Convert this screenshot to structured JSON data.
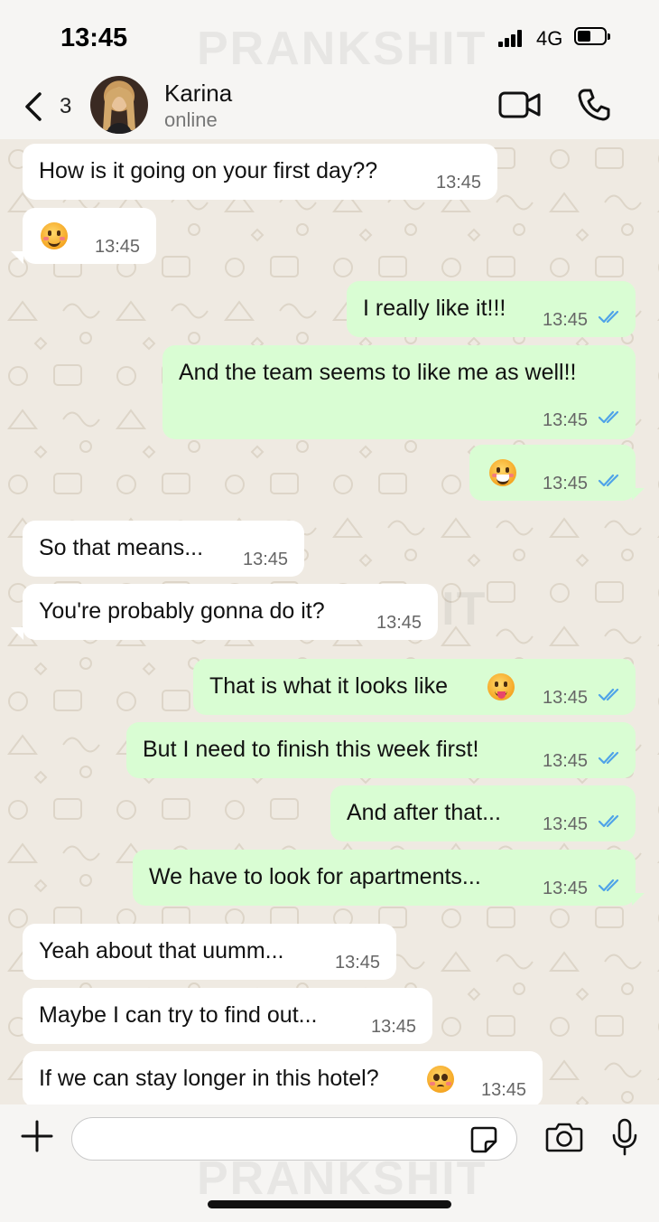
{
  "status_bar": {
    "time": "13:45",
    "network": "4G",
    "watermark": "PRANKSHIT"
  },
  "header": {
    "back_count": "3",
    "contact_name": "Karina",
    "contact_status": "online",
    "icons": [
      "chevron-left-icon",
      "video-camera-icon",
      "phone-icon"
    ]
  },
  "messages": [
    {
      "dir": "in",
      "text": "How is it going on your first day??",
      "time": "13:45"
    },
    {
      "dir": "in",
      "text": "",
      "emoji": "smiling-face-emoji",
      "time": "13:45"
    },
    {
      "dir": "out",
      "text": "I really like it!!!",
      "time": "13:45",
      "read": true
    },
    {
      "dir": "out",
      "text": "And the team seems to like me as well!!",
      "time": "13:45",
      "read": true
    },
    {
      "dir": "out",
      "text": "",
      "emoji": "grinning-face-emoji",
      "time": "13:45",
      "read": true
    },
    {
      "dir": "in",
      "text": "So that means...",
      "time": "13:45"
    },
    {
      "dir": "in",
      "text": "You're probably gonna do it?",
      "time": "13:45"
    },
    {
      "dir": "out",
      "text": "That is what it looks like",
      "emoji": "tongue-face-emoji",
      "time": "13:45",
      "read": true
    },
    {
      "dir": "out",
      "text": "But I need to finish this week first!",
      "time": "13:45",
      "read": true
    },
    {
      "dir": "out",
      "text": "And after that...",
      "time": "13:45",
      "read": true
    },
    {
      "dir": "out",
      "text": "We have to look for apartments...",
      "time": "13:45",
      "read": true
    },
    {
      "dir": "in",
      "text": "Yeah about that uumm...",
      "time": "13:45"
    },
    {
      "dir": "in",
      "text": "Maybe I can try to find out...",
      "time": "13:45"
    },
    {
      "dir": "in",
      "text": "If we can stay longer in this hotel?",
      "emoji": "pleading-face-emoji",
      "time": "13:45"
    }
  ],
  "input_bar": {
    "value": "",
    "placeholder": "",
    "icons": [
      "plus-icon",
      "sticker-icon",
      "camera-icon",
      "microphone-icon"
    ]
  },
  "colors": {
    "incoming_bubble": "#ffffff",
    "outgoing_bubble": "#d9fdd3",
    "read_tick": "#4fa3e8",
    "chat_background": "#efeae2"
  }
}
